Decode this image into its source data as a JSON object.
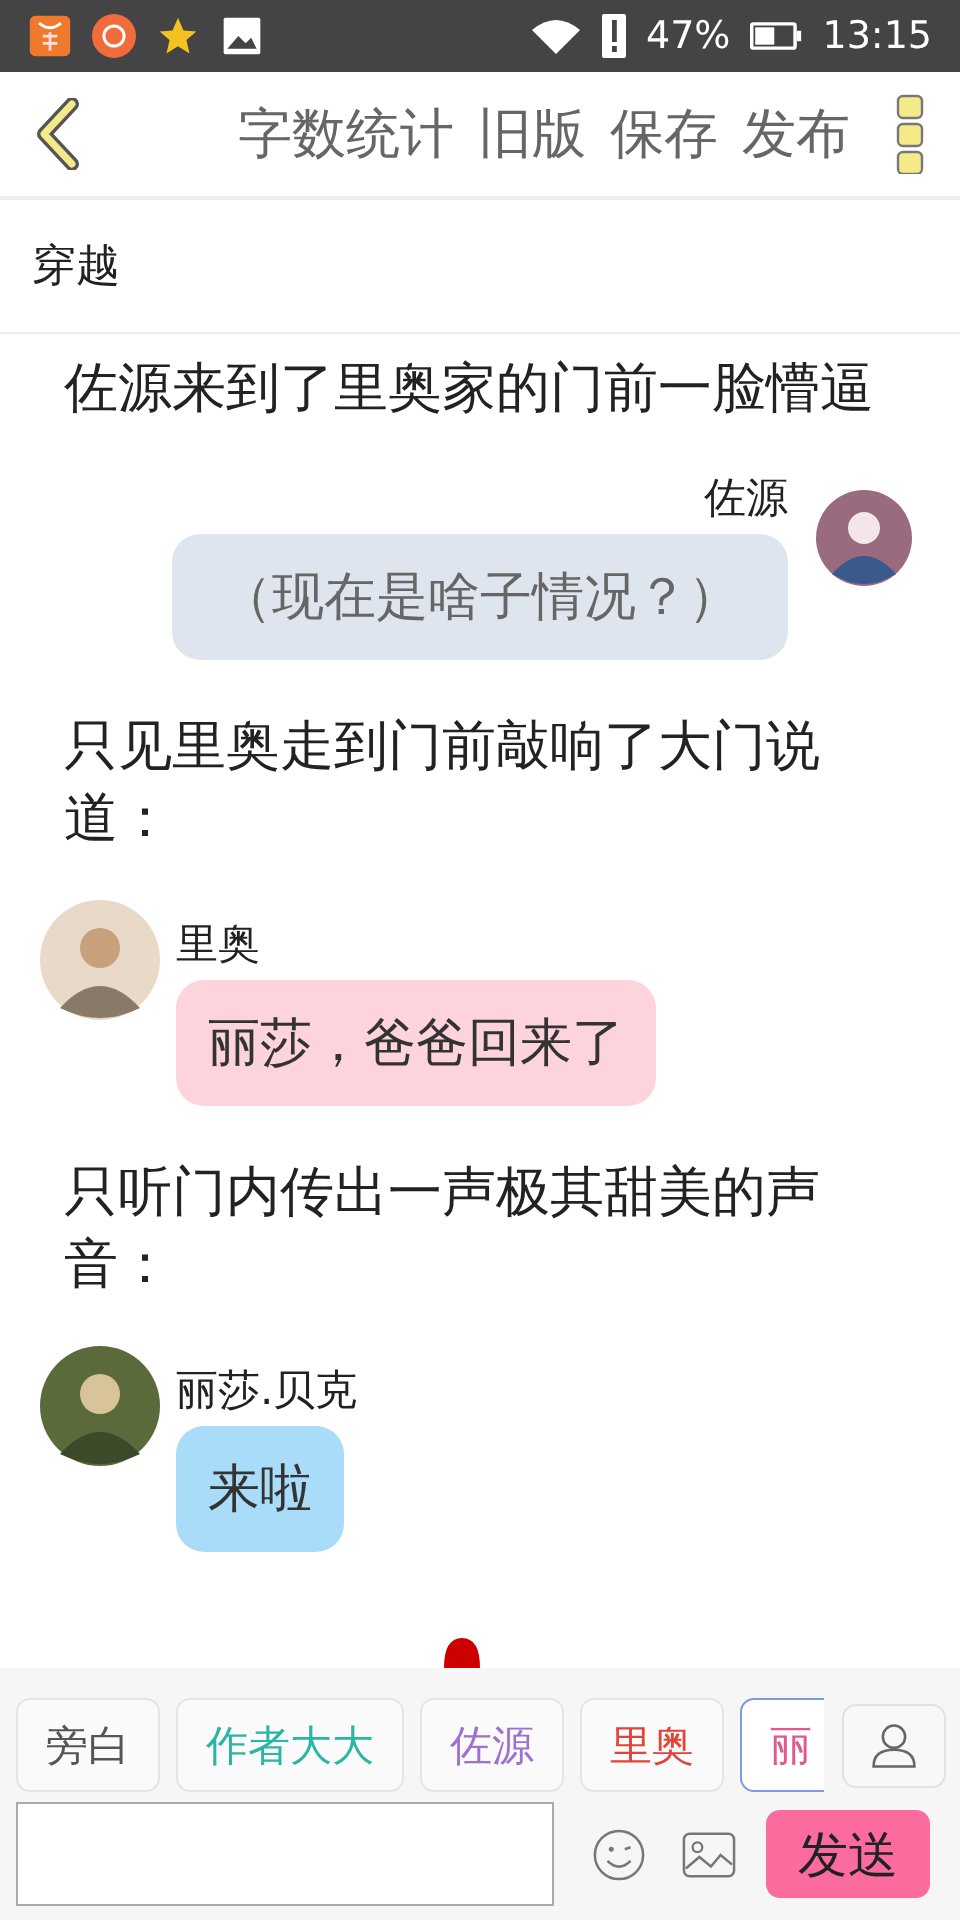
{
  "status_bar": {
    "battery": "47%",
    "time": "13:15"
  },
  "toolbar": {
    "actions": [
      "字数统计",
      "旧版",
      "保存",
      "发布"
    ]
  },
  "chapter_title": "穿越",
  "messages": [
    {
      "kind": "narration",
      "text": "佐源来到了里奥家的门前一脸懵逼"
    },
    {
      "kind": "right",
      "name": "佐源",
      "text": "（现在是啥子情况？）",
      "color": "#dfe5ee"
    },
    {
      "kind": "narration",
      "text": "只见里奥走到门前敲响了大门说道："
    },
    {
      "kind": "left",
      "name": "里奥",
      "text": "丽莎，爸爸回来了",
      "color": "#fdd3dc"
    },
    {
      "kind": "narration",
      "text": "只听门内传出一声极其甜美的声音："
    },
    {
      "kind": "left",
      "name": "丽莎.贝克",
      "text": "来啦",
      "color": "#a8dcf8"
    }
  ],
  "roles": [
    {
      "label": "旁白",
      "color": "#555555",
      "selected": false
    },
    {
      "label": "作者大大",
      "color": "#2bb5a6",
      "selected": false
    },
    {
      "label": "佐源",
      "color": "#a070d0",
      "selected": false
    },
    {
      "label": "里奥",
      "color": "#e0443a",
      "selected": false
    },
    {
      "label": "丽",
      "color": "#e05a8c",
      "selected": true
    }
  ],
  "composer": {
    "send_label": "发送"
  }
}
